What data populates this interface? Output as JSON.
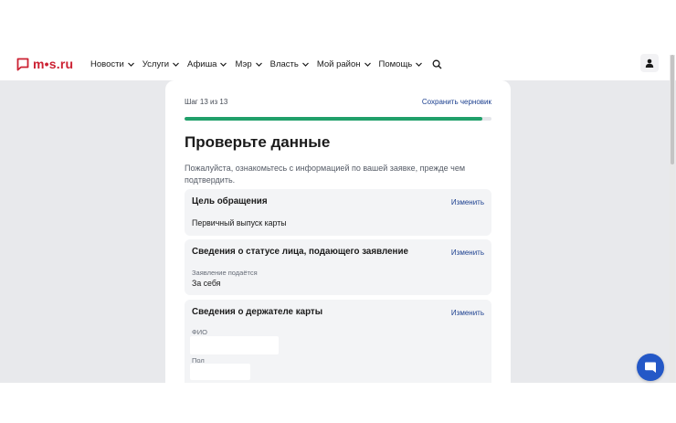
{
  "header": {
    "logo_text": "m•s.ru",
    "nav": [
      {
        "label": "Новости",
        "name": "nav-item-news"
      },
      {
        "label": "Услуги",
        "name": "nav-item-services"
      },
      {
        "label": "Афиша",
        "name": "nav-item-afisha"
      },
      {
        "label": "Мэр",
        "name": "nav-item-mayor"
      },
      {
        "label": "Власть",
        "name": "nav-item-government"
      },
      {
        "label": "Мой район",
        "name": "nav-item-my-district"
      },
      {
        "label": "Помощь",
        "name": "nav-item-help"
      }
    ],
    "icons": {
      "search": "search-icon",
      "user": "user-icon",
      "logo": "logo-icon"
    }
  },
  "form": {
    "step": "Шаг 13 из 13",
    "save_draft": "Сохранить черновик",
    "progress": 0.97,
    "title": "Проверьте данные",
    "description": "Пожалуйста, ознакомьтесь с информацией по вашей заявке, прежде чем подтвердить."
  },
  "sections": [
    {
      "title": "Цель обращения",
      "edit": "Изменить",
      "value": "Первичный выпуск карты"
    },
    {
      "title": "Сведения о статусе лица, подающего заявление",
      "edit": "Изменить",
      "label": "Заявление подаётся",
      "value": "За себя"
    },
    {
      "title": "Сведения о держателе карты",
      "edit": "Изменить",
      "label_fio": "ФИО",
      "label_gender": "Пол"
    }
  ],
  "colors": {
    "brand_red": "#cc2233",
    "link_blue": "#1b3f8f",
    "progress_green": "#20a06a",
    "chat_blue": "#2458c7"
  }
}
